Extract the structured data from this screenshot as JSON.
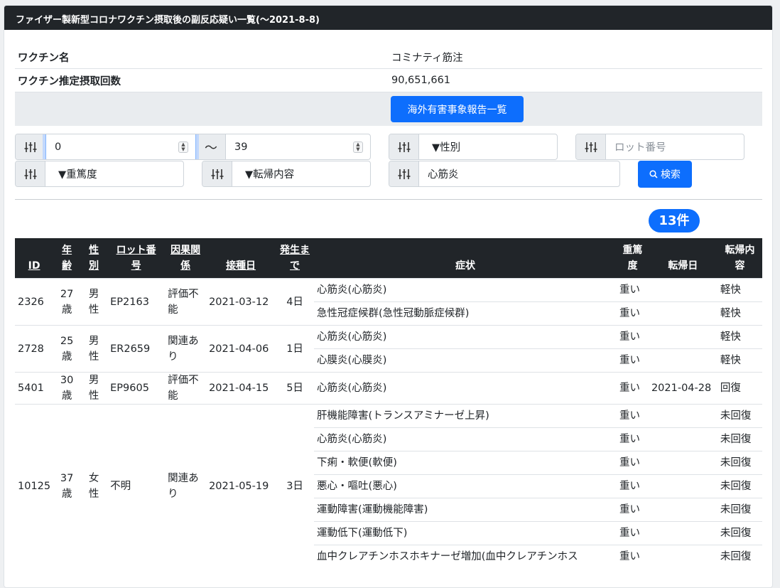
{
  "header": {
    "title": "ファイザー製新型コロナワクチン摂取後の副反応疑い一覧(〜2021-8-8)"
  },
  "info": {
    "vaccine_label": "ワクチン名",
    "vaccine_value": "コミナティ筋注",
    "doses_label": "ワクチン推定摂取回数",
    "doses_value": "90,651,661",
    "overseas_button": "海外有害事象報告一覧"
  },
  "filters": {
    "age_from": "0",
    "tilde": "〜",
    "age_to": "39",
    "gender": "▼性別",
    "lot_placeholder": "ロット番号",
    "severity": "▼重篤度",
    "outcome": "▼転帰内容",
    "symptom": "心筋炎",
    "search_button": "検索"
  },
  "count_badge": "13件",
  "table": {
    "headers": {
      "id": "ID",
      "age_1": "年",
      "age_2": "齢",
      "sex_1": "性",
      "sex_2": "別",
      "lot_1": "ロット番",
      "lot_2": "号",
      "causal_1": "因果関",
      "causal_2": "係",
      "date": "接種日",
      "onset_1": "発生ま",
      "onset_2": "で",
      "symptom": "症状",
      "severity_1": "重篤",
      "severity_2": "度",
      "outcome_date": "転帰日",
      "outcome_1": "転帰内",
      "outcome_2": "容"
    },
    "records": [
      {
        "id": "2326",
        "age_1": "27",
        "age_2": "歳",
        "sex_1": "男",
        "sex_2": "性",
        "lot": "EP2163",
        "causal_1": "評価不",
        "causal_2": "能",
        "date": "2021-03-12",
        "onset": "4日",
        "symptoms": [
          {
            "name": "心筋炎(心筋炎)",
            "severity": "重い",
            "outcome_date": "",
            "outcome": "軽快"
          },
          {
            "name": "急性冠症候群(急性冠動脈症候群)",
            "severity": "重い",
            "outcome_date": "",
            "outcome": "軽快"
          }
        ]
      },
      {
        "id": "2728",
        "age_1": "25",
        "age_2": "歳",
        "sex_1": "男",
        "sex_2": "性",
        "lot": "ER2659",
        "causal_1": "関連あ",
        "causal_2": "り",
        "date": "2021-04-06",
        "onset": "1日",
        "symptoms": [
          {
            "name": "心筋炎(心筋炎)",
            "severity": "重い",
            "outcome_date": "",
            "outcome": "軽快"
          },
          {
            "name": "心膜炎(心膜炎)",
            "severity": "重い",
            "outcome_date": "",
            "outcome": "軽快"
          }
        ]
      },
      {
        "id": "5401",
        "age_1": "30",
        "age_2": "歳",
        "sex_1": "男",
        "sex_2": "性",
        "lot": "EP9605",
        "causal_1": "評価不",
        "causal_2": "能",
        "date": "2021-04-15",
        "onset": "5日",
        "symptoms": [
          {
            "name": "心筋炎(心筋炎)",
            "severity": "重い",
            "outcome_date": "2021-04-28",
            "outcome": "回復"
          }
        ]
      },
      {
        "id": "10125",
        "age_1": "37",
        "age_2": "歳",
        "sex_1": "女",
        "sex_2": "性",
        "lot": "不明",
        "causal_1": "関連あ",
        "causal_2": "り",
        "date": "2021-05-19",
        "onset": "3日",
        "symptoms": [
          {
            "name": "肝機能障害(トランスアミナーゼ上昇)",
            "severity": "重い",
            "outcome_date": "",
            "outcome": "未回復"
          },
          {
            "name": "心筋炎(心筋炎)",
            "severity": "重い",
            "outcome_date": "",
            "outcome": "未回復"
          },
          {
            "name": "下痢・軟便(軟便)",
            "severity": "重い",
            "outcome_date": "",
            "outcome": "未回復"
          },
          {
            "name": "悪心・嘔吐(悪心)",
            "severity": "重い",
            "outcome_date": "",
            "outcome": "未回復"
          },
          {
            "name": "運動障害(運動機能障害)",
            "severity": "重い",
            "outcome_date": "",
            "outcome": "未回復"
          },
          {
            "name": "運動低下(運動低下)",
            "severity": "重い",
            "outcome_date": "",
            "outcome": "未回復"
          },
          {
            "name": "血中クレアチンホスホキナーゼ増加(血中クレアチンホス",
            "severity": "重い",
            "outcome_date": "",
            "outcome": "未回復"
          }
        ]
      }
    ]
  }
}
